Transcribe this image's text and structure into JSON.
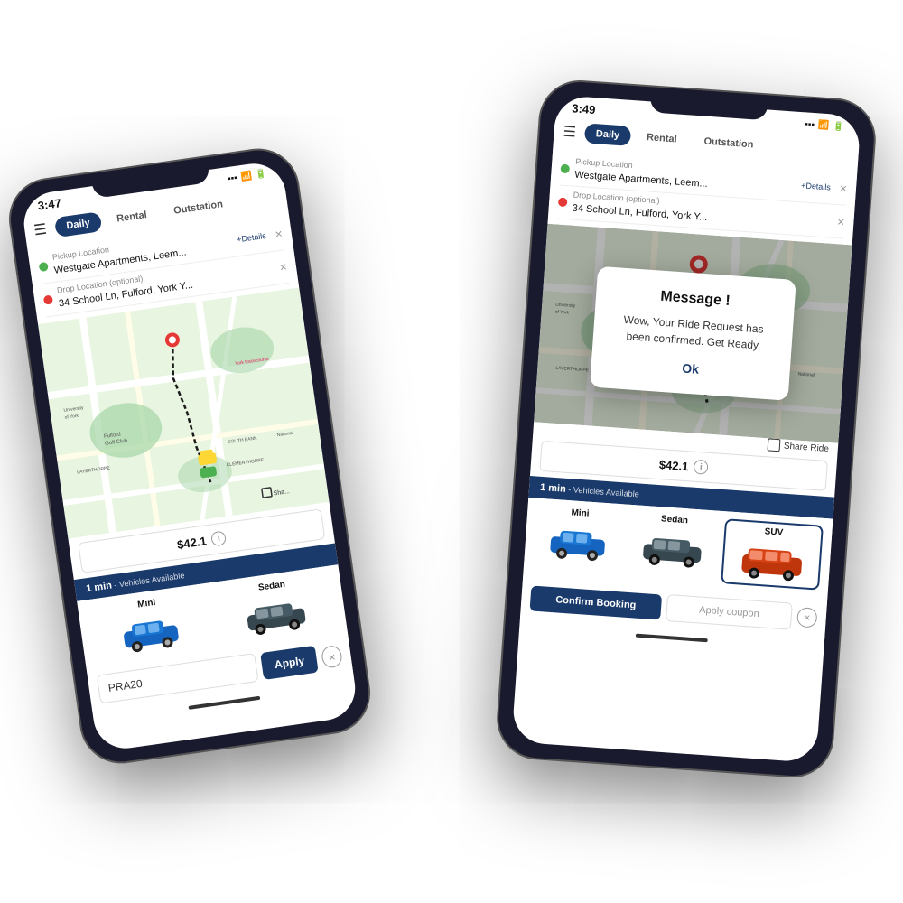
{
  "scene": {
    "background": "white"
  },
  "phone1": {
    "time": "3:47",
    "tabs": {
      "daily": "Daily",
      "rental": "Rental",
      "outstation": "Outstation",
      "active": "Daily"
    },
    "pickup": {
      "label": "Pickup Location",
      "value": "Westgate Apartments, Leem...",
      "detail": "+Details"
    },
    "drop": {
      "label": "Drop Location (optional)",
      "value": "34 School Ln, Fulford, York Y..."
    },
    "price": "$42.1",
    "vehicles_header": "1 min",
    "vehicles_subheader": " - Vehicles Available",
    "vehicles": [
      {
        "label": "Mini",
        "selected": false
      },
      {
        "label": "Sedan",
        "selected": false
      }
    ],
    "coupon_placeholder": "PRA20",
    "apply_label": "Apply"
  },
  "phone2": {
    "time": "3:49",
    "tabs": {
      "daily": "Daily",
      "rental": "Rental",
      "outstation": "Outstation",
      "active": "Daily"
    },
    "pickup": {
      "label": "Pickup Location",
      "value": "Westgate Apartments, Leem...",
      "detail": "+Details"
    },
    "drop": {
      "label": "Drop Location (optional)",
      "value": "34 School Ln, Fulford, York Y..."
    },
    "price": "$42.1",
    "share_ride": "Share Ride",
    "vehicles_header": "1 min",
    "vehicles_subheader": " - Vehicles Available",
    "vehicles": [
      {
        "label": "Mini",
        "selected": false
      },
      {
        "label": "Sedan",
        "selected": false
      },
      {
        "label": "SUV",
        "selected": true
      }
    ],
    "confirm_label": "Confirm Booking",
    "coupon_label": "Apply coupon",
    "modal": {
      "title": "Message !",
      "body": "Wow, Your Ride Request has been confirmed. Get Ready",
      "ok": "Ok"
    }
  }
}
